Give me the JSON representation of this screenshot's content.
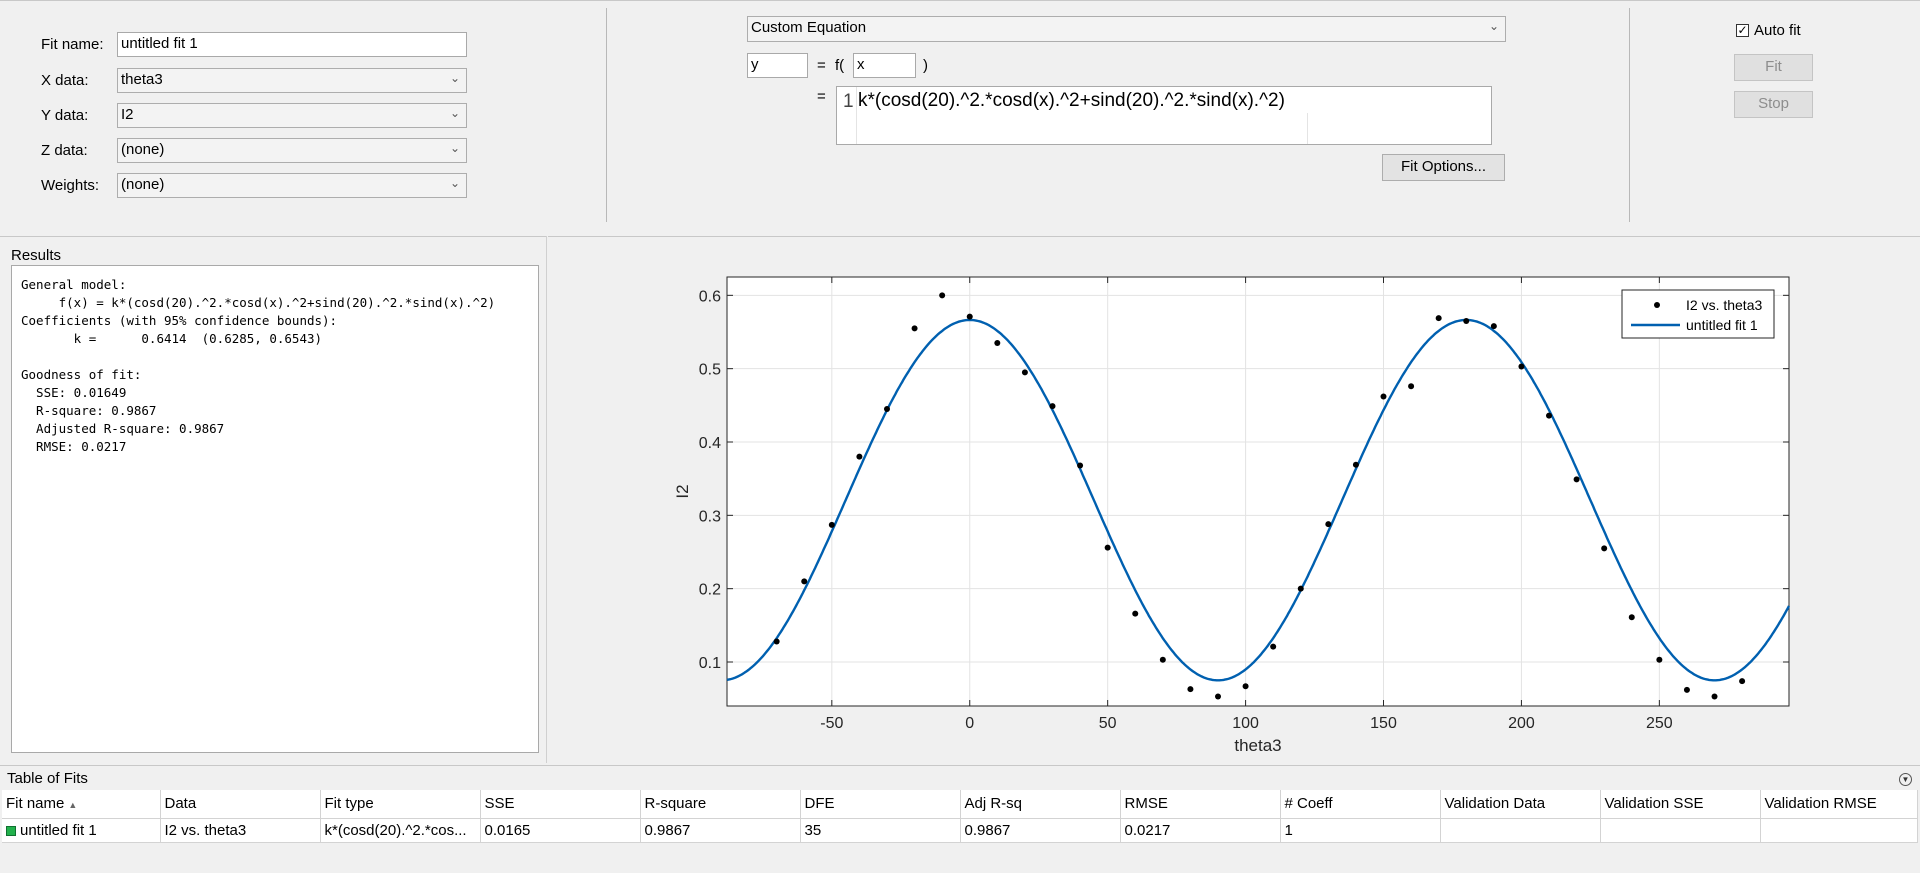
{
  "fit_panel": {
    "fit_name_label": "Fit name:",
    "fit_name_value": "untitled fit 1",
    "x_data_label": "X data:",
    "x_data_value": "theta3",
    "y_data_label": "Y data:",
    "y_data_value": "I2",
    "z_data_label": "Z data:",
    "z_data_value": "(none)",
    "weights_label": "Weights:",
    "weights_value": "(none)"
  },
  "equation_panel": {
    "type_value": "Custom Equation",
    "y_var": "y",
    "eq_sign": "=",
    "f_open": "f(",
    "x_var": "x",
    "f_close": ")",
    "eq_sign2": "=",
    "line_number": "1",
    "equation": "k*(cosd(20).^2.*cosd(x).^2+sind(20).^2.*sind(x).^2)",
    "fit_options_label": "Fit Options..."
  },
  "controls": {
    "auto_fit_label": "Auto fit",
    "auto_fit_checked": true,
    "fit_label": "Fit",
    "stop_label": "Stop"
  },
  "results": {
    "title": "Results",
    "text": "General model:\n     f(x) = k*(cosd(20).^2.*cosd(x).^2+sind(20).^2.*sind(x).^2)\nCoefficients (with 95% confidence bounds):\n       k =      0.6414  (0.6285, 0.6543)\n\nGoodness of fit:\n  SSE: 0.01649\n  R-square: 0.9867\n  Adjusted R-square: 0.9867\n  RMSE: 0.0217"
  },
  "chart_data": {
    "type": "scatter",
    "xlabel": "theta3",
    "ylabel": "I2",
    "xlim": [
      -88,
      297
    ],
    "ylim": [
      0.04,
      0.625
    ],
    "xticks": [
      -50,
      0,
      50,
      100,
      150,
      200,
      250
    ],
    "yticks": [
      0.1,
      0.2,
      0.3,
      0.4,
      0.5,
      0.6
    ],
    "grid": true,
    "legend_position": "top-right",
    "series": [
      {
        "name": "I2 vs. theta3",
        "kind": "points",
        "color": "#000000",
        "x": [
          -70,
          -60,
          -50,
          -40,
          -30,
          -20,
          -10,
          0,
          10,
          20,
          30,
          40,
          50,
          60,
          70,
          80,
          90,
          100,
          110,
          120,
          130,
          140,
          150,
          160,
          170,
          180,
          190,
          200,
          210,
          220,
          230,
          240,
          250,
          260,
          270,
          280
        ],
        "y": [
          0.128,
          0.21,
          0.287,
          0.38,
          0.445,
          0.555,
          0.6,
          0.571,
          0.535,
          0.495,
          0.449,
          0.368,
          0.256,
          0.166,
          0.103,
          0.063,
          0.053,
          0.067,
          0.121,
          0.2,
          0.288,
          0.369,
          0.462,
          0.476,
          0.569,
          0.565,
          0.558,
          0.503,
          0.436,
          0.349,
          0.255,
          0.161,
          0.103,
          0.062,
          0.053,
          0.074
        ]
      },
      {
        "name": "untitled fit 1",
        "kind": "curve",
        "color": "#0060b0",
        "k": 0.6414
      }
    ]
  },
  "table_of_fits": {
    "title": "Table of Fits",
    "headers": [
      "Fit name",
      "Data",
      "Fit type",
      "SSE",
      "R-square",
      "DFE",
      "Adj R-sq",
      "RMSE",
      "# Coeff",
      "Validation Data",
      "Validation SSE",
      "Validation RMSE"
    ],
    "rows": [
      [
        "untitled fit 1",
        "I2 vs. theta3",
        "k*(cosd(20).^2.*cos...",
        "0.0165",
        "0.9867",
        "35",
        "0.9867",
        "0.0217",
        "1",
        "",
        "",
        ""
      ]
    ],
    "fit_color": "#22b14c"
  }
}
